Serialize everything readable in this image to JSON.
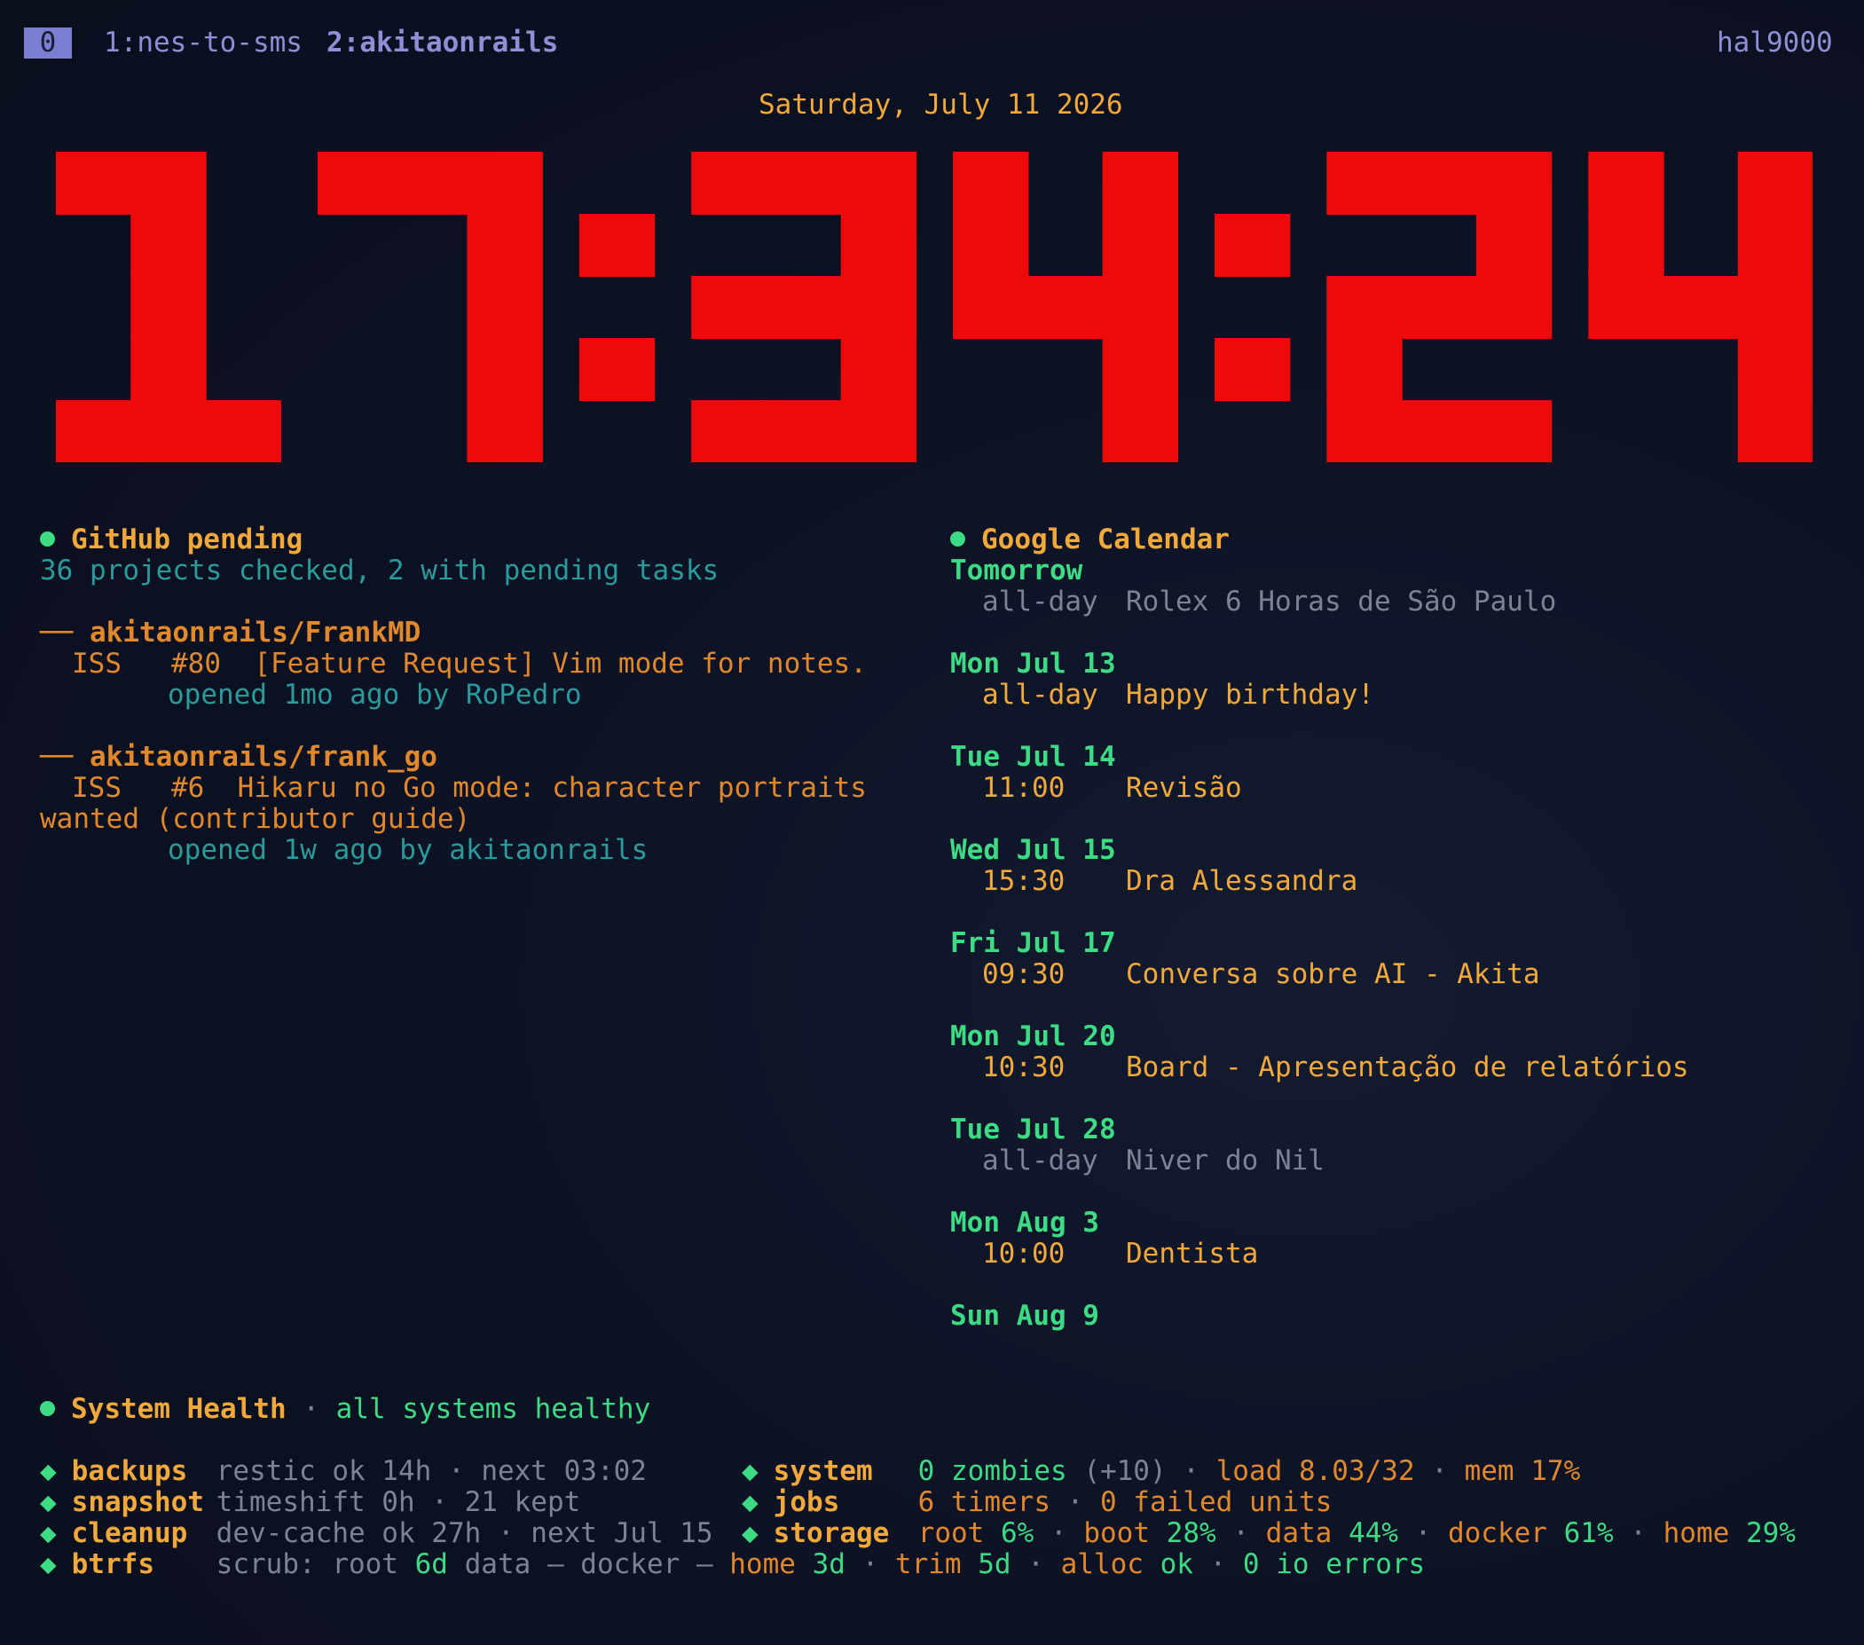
{
  "tmux": {
    "active_window": "0",
    "windows": [
      "1:nes-to-sms",
      "2:akitaonrails"
    ],
    "host": "hal9000"
  },
  "date": "Saturday, July 11 2026",
  "clock": {
    "time": "17:34:24",
    "color": "#ee0a0a"
  },
  "github": {
    "title": "GitHub pending",
    "summary": "36 projects checked, 2 with pending tasks",
    "repos": [
      {
        "name": "akitaonrails/FrankMD",
        "issue_type": "ISS",
        "issue_number": "#80",
        "issue_title": "[Feature Request] Vim mode for notes.",
        "meta": "opened 1mo ago by RoPedro"
      },
      {
        "name": "akitaonrails/frank_go",
        "issue_type": "ISS",
        "issue_number": "#6",
        "issue_title": "Hikaru no Go mode: character portraits",
        "issue_title_cont": "wanted (contributor guide)",
        "meta": "opened 1w ago by akitaonrails"
      }
    ]
  },
  "calendar": {
    "title": "Google Calendar",
    "days": [
      {
        "day": "Tomorrow",
        "time": "all-day",
        "event": "Rolex 6 Horas de São Paulo",
        "muted": true
      },
      {
        "day": "Mon Jul 13",
        "time": "all-day",
        "event": "Happy birthday!",
        "muted": false
      },
      {
        "day": "Tue Jul 14",
        "time": "11:00",
        "event": "Revisão",
        "muted": false
      },
      {
        "day": "Wed Jul 15",
        "time": "15:30",
        "event": "Dra Alessandra",
        "muted": false
      },
      {
        "day": "Fri Jul 17",
        "time": "09:30",
        "event": "Conversa sobre AI - Akita",
        "muted": false
      },
      {
        "day": "Mon Jul 20",
        "time": "10:30",
        "event": "Board - Apresentação de relatórios",
        "muted": false
      },
      {
        "day": "Tue Jul 28",
        "time": "all-day",
        "event": "Niver do Nil",
        "muted": true
      },
      {
        "day": "Mon Aug 3",
        "time": "10:00",
        "event": "Dentista",
        "muted": false
      },
      {
        "day": "Sun Aug 9",
        "time": "",
        "event": "",
        "muted": false
      }
    ]
  },
  "health": {
    "title": "System Health",
    "sep": "·",
    "status": "all systems healthy",
    "left": [
      {
        "label": "backups",
        "parts": [
          [
            "restic ok 14h",
            "grey"
          ],
          [
            " · ",
            "grey"
          ],
          [
            "next 03:02",
            "grey"
          ]
        ]
      },
      {
        "label": "snapshot",
        "parts": [
          [
            "timeshift 0h",
            "grey"
          ],
          [
            " · ",
            "grey"
          ],
          [
            "21 kept",
            "grey"
          ]
        ]
      },
      {
        "label": "cleanup",
        "parts": [
          [
            "dev-cache ok 27h",
            "grey"
          ],
          [
            " · ",
            "grey"
          ],
          [
            "next Jul 15",
            "grey"
          ]
        ]
      },
      {
        "label": "btrfs",
        "parts": [
          [
            "scrub: root ",
            "grey"
          ],
          [
            "6d",
            "green"
          ],
          [
            " data ",
            "grey"
          ],
          [
            "—",
            "grey"
          ],
          [
            " docker ",
            "grey"
          ],
          [
            "—",
            "grey"
          ],
          [
            " home ",
            "orange"
          ],
          [
            "3d",
            "green"
          ],
          [
            " · ",
            "grey"
          ],
          [
            "trim ",
            "orange"
          ],
          [
            "5d",
            "green"
          ],
          [
            " · ",
            "grey"
          ],
          [
            "alloc ",
            "orange"
          ],
          [
            "ok",
            "green"
          ],
          [
            " · ",
            "grey"
          ],
          [
            "0 io errors",
            "green"
          ]
        ]
      }
    ],
    "right": [
      {
        "label": "system",
        "parts": [
          [
            "0 zombies",
            "green"
          ],
          [
            " (+10)",
            "grey"
          ],
          [
            " · ",
            "grey"
          ],
          [
            "load 8.03/32",
            "orange"
          ],
          [
            " · ",
            "grey"
          ],
          [
            "mem 17%",
            "orange"
          ]
        ]
      },
      {
        "label": "jobs",
        "parts": [
          [
            "6 timers",
            "orange"
          ],
          [
            " · ",
            "grey"
          ],
          [
            "0 failed units",
            "orange"
          ]
        ]
      },
      {
        "label": "storage",
        "parts": [
          [
            "root ",
            "orange"
          ],
          [
            "6%",
            "green"
          ],
          [
            " · ",
            "grey"
          ],
          [
            "boot ",
            "orange"
          ],
          [
            "28%",
            "green"
          ],
          [
            " · ",
            "grey"
          ],
          [
            "data ",
            "orange"
          ],
          [
            "44%",
            "green"
          ],
          [
            " · ",
            "grey"
          ],
          [
            "docker ",
            "orange"
          ],
          [
            "61%",
            "green"
          ],
          [
            " · ",
            "grey"
          ],
          [
            "home ",
            "orange"
          ],
          [
            "29%",
            "green"
          ]
        ]
      }
    ]
  }
}
